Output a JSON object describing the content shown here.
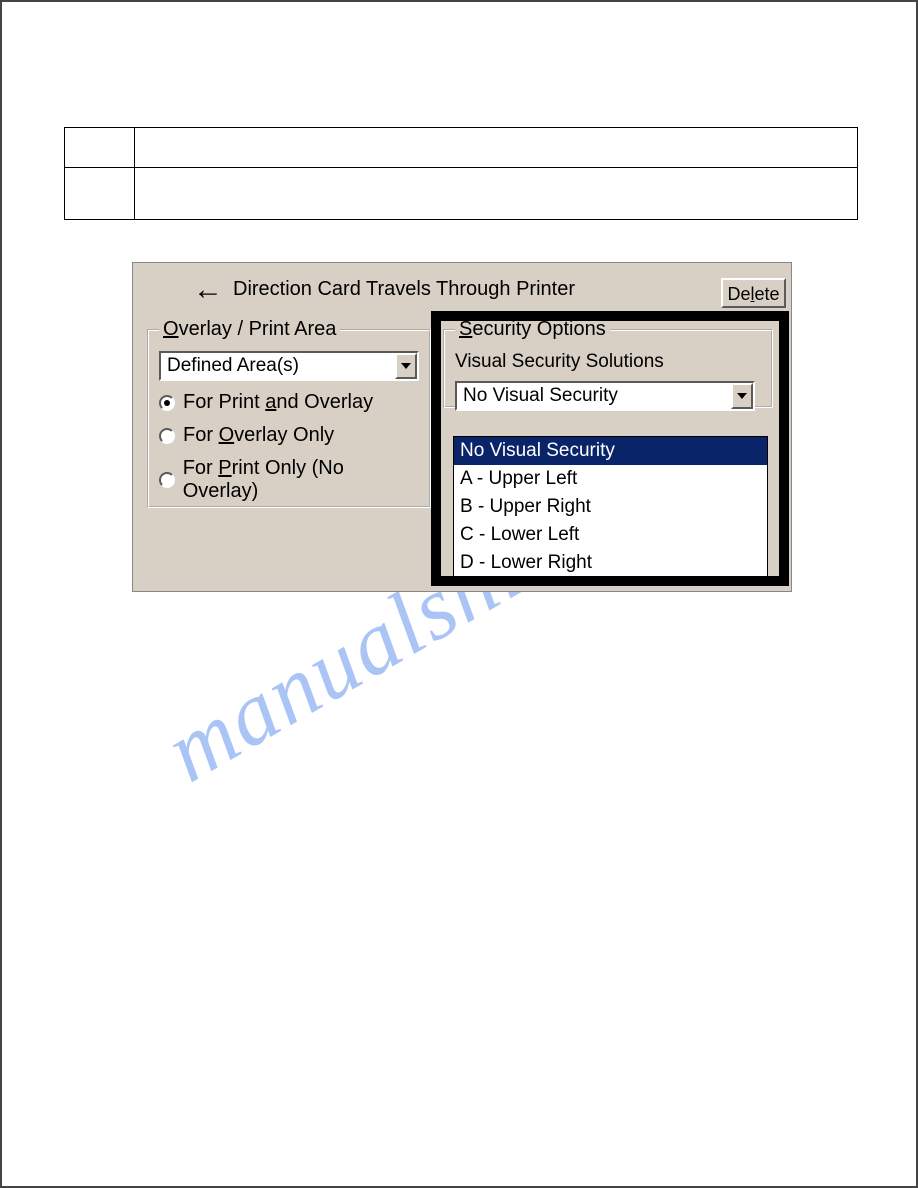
{
  "direction_label": "Direction Card Travels Through Printer",
  "delete_button": "Delete",
  "overlay": {
    "legend_u": "O",
    "legend_rest": "verlay / Print Area",
    "combo_value": "Defined Area(s)",
    "radios": {
      "r1_pre": "For Print ",
      "r1_u": "a",
      "r1_post": "nd Overlay",
      "r2_pre": "For ",
      "r2_u": "O",
      "r2_post": "verlay Only",
      "r3_pre": "For ",
      "r3_u": "P",
      "r3_post": "rint Only (No Overlay)"
    }
  },
  "security": {
    "legend_u": "S",
    "legend_rest": "ecurity Options",
    "sublabel": "Visual Security Solutions",
    "combo_value": "No Visual Security",
    "options": [
      "No Visual Security",
      "A - Upper Left",
      "B - Upper Right",
      "C - Lower Left",
      "D - Lower Right"
    ]
  },
  "watermark": "manualshive.com"
}
